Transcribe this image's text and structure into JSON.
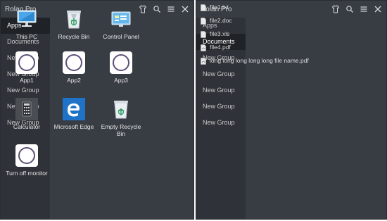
{
  "left": {
    "title": "Rolan Pro",
    "sidebar": [
      "Apps",
      "Documents",
      "New Group",
      "New Group",
      "New Group",
      "New Group",
      "New Group"
    ],
    "tiles": [
      {
        "label": "This PC",
        "icon": "computer-icon"
      },
      {
        "label": "Recycle Bin",
        "icon": "recycle-bin-icon"
      },
      {
        "label": "Control Panel",
        "icon": "control-panel-icon"
      },
      {
        "label": "App1",
        "icon": "app-icon"
      },
      {
        "label": "App2",
        "icon": "app-icon"
      },
      {
        "label": "App3",
        "icon": "app-icon"
      },
      {
        "label": "Calculator",
        "icon": "calculator-icon"
      },
      {
        "label": "Microsoft Edge",
        "icon": "edge-icon"
      },
      {
        "label": "Empty Recycle Bin",
        "icon": "empty-recycle-bin-icon"
      },
      {
        "label": "Turn off monitor",
        "icon": "app-icon"
      }
    ]
  },
  "right": {
    "title": "Rolan Pro",
    "sidebar": [
      "Apps",
      "Documents",
      "New Group",
      "New Group",
      "New Group",
      "New Group",
      "New Group"
    ],
    "files": [
      "file1.txt",
      "file2.doc",
      "file3.xls",
      "file4.pdf",
      "long long long long long file name.pdf"
    ]
  },
  "colors": {
    "window_bg": "#383c43",
    "sidebar_bg": "#2f3238",
    "active_bg": "#1f2226",
    "text": "#e8e8e8"
  }
}
